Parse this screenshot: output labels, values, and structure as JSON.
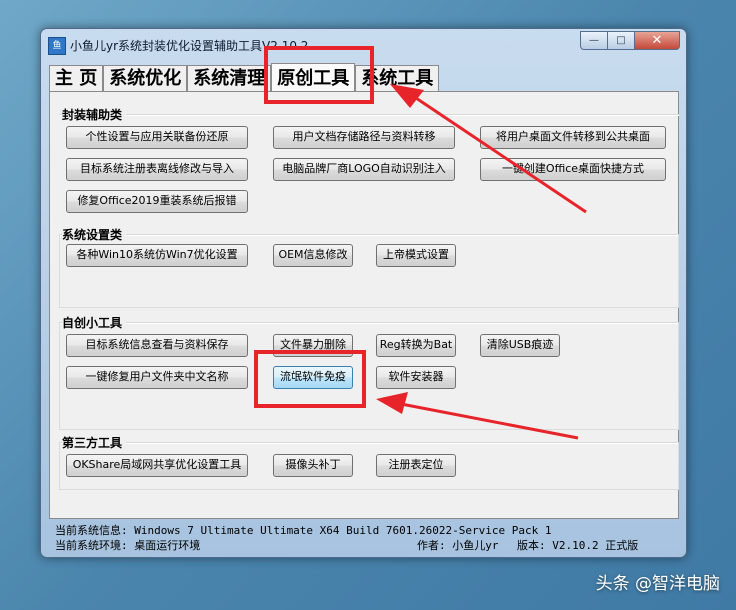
{
  "window": {
    "title": "小鱼儿yr系统封装优化设置辅助工具V2.10.2",
    "icon_text": "鱼",
    "controls": {
      "minimize": "—",
      "maximize": "□",
      "close": "✕"
    }
  },
  "tabs": [
    "主 页",
    "系统优化",
    "系统清理",
    "原创工具",
    "系统工具"
  ],
  "active_tab": "原创工具",
  "groups": {
    "packaging": {
      "title": "封装辅助类",
      "buttons": [
        "个性设置与应用关联备份还原",
        "用户文档存储路径与资料转移",
        "将用户桌面文件转移到公共桌面",
        "目标系统注册表离线修改与导入",
        "电脑品牌厂商LOGO自动识别注入",
        "一键创建Office桌面快捷方式",
        "修复Office2019重装系统后报错"
      ]
    },
    "system_settings": {
      "title": "系统设置类",
      "buttons": [
        "各种Win10系统仿Win7优化设置",
        "OEM信息修改",
        "上帝模式设置"
      ]
    },
    "original_tools": {
      "title": "自创小工具",
      "buttons": [
        "目标系统信息查看与资料保存",
        "文件暴力删除",
        "Reg转换为Bat",
        "清除USB痕迹",
        "一键修复用户文件夹中文名称",
        "流氓软件免疫",
        "软件安装器"
      ]
    },
    "third_party": {
      "title": "第三方工具",
      "buttons": [
        "OKShare局域网共享优化设置工具",
        "摄像头补丁",
        "注册表定位"
      ]
    }
  },
  "status": {
    "system_info": "当前系统信息: Windows 7 Ultimate Ultimate X64 Build 7601.26022-Service Pack 1",
    "environment": "当前系统环境: 桌面运行环境",
    "author": "作者: 小鱼儿yr",
    "version": "版本: V2.10.2 正式版"
  },
  "watermark": "头条 @智洋电脑",
  "colors": {
    "annotation": "#e8242b",
    "highlight_button": "#bee6fd"
  }
}
